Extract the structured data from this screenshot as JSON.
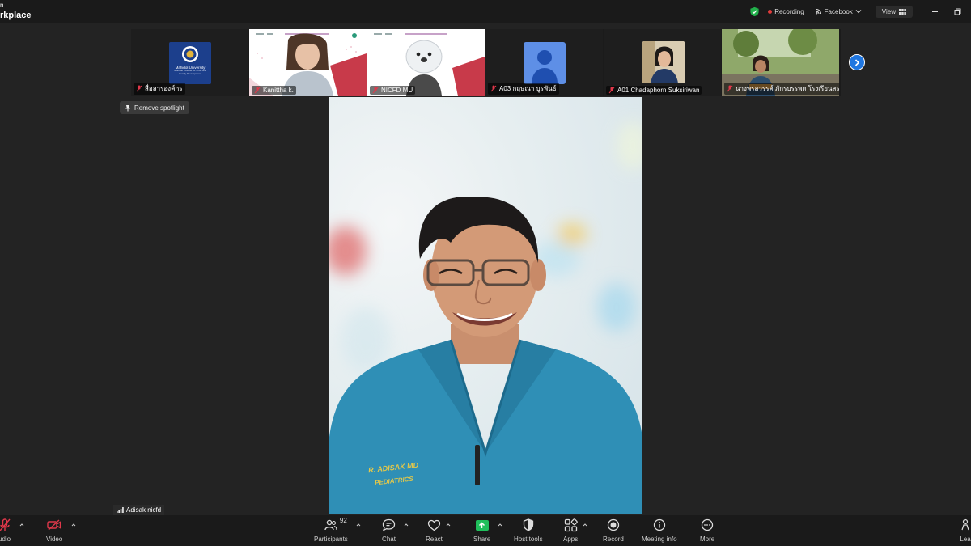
{
  "app": {
    "brand_line1": "n",
    "brand_line2": "rkplace",
    "recording_label": "Recording",
    "facebook_label": "Facebook",
    "view_label": "View"
  },
  "gallery": {
    "tiles": [
      {
        "label": "สื่อสารองค์กร",
        "logo_title": "Mahidol University",
        "logo_sub": "National Institute for Child and Family Development"
      },
      {
        "label": "Kanittha k."
      },
      {
        "label": "NICFD MU"
      },
      {
        "label": "A03 กฤษณา บูรพันธ์"
      },
      {
        "label": "A01 Chadaphorn Suksiriwan"
      },
      {
        "label": "นางพรสวรรค์ ภักรบรรพต โรงเรียนสร..."
      }
    ]
  },
  "spotlight": {
    "remove_label": "Remove spotlight"
  },
  "main_video": {
    "speaker_name": "Adisak nicfd",
    "scrub_text_line1": "R. ADISAK MD",
    "scrub_text_line2": "PEDIATRICS"
  },
  "toolbar": {
    "audio_label": "udio",
    "video_label": "Video",
    "participants_label": "Participants",
    "participants_count": "92",
    "chat_label": "Chat",
    "react_label": "React",
    "share_label": "Share",
    "host_tools_label": "Host tools",
    "apps_label": "Apps",
    "record_label": "Record",
    "meeting_info_label": "Meeting info",
    "more_label": "More",
    "leave_label": "Lea"
  },
  "colors": {
    "accent_blue": "#1f76e0",
    "share_green": "#1fbf5b",
    "recording_red": "#e23b3b",
    "muted_red": "#e0384a",
    "scrubs_teal": "#2f8fb6"
  }
}
